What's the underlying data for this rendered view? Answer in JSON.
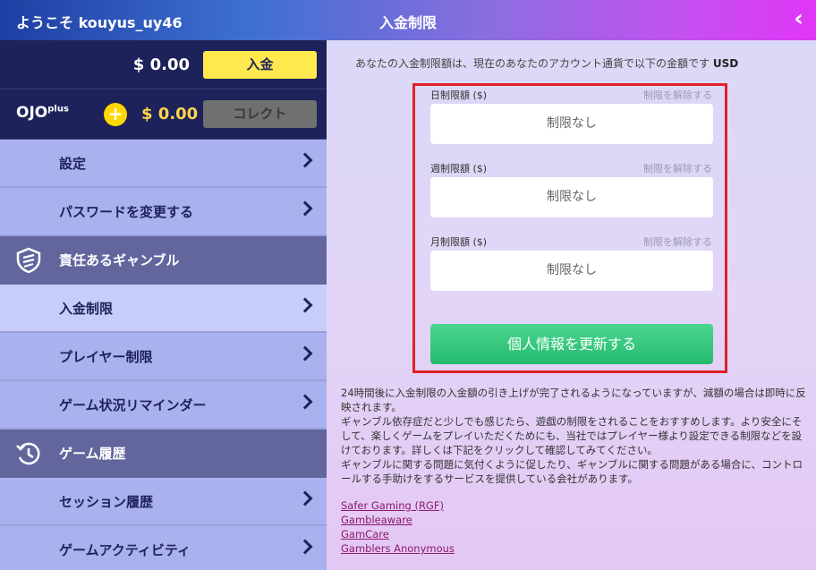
{
  "header": {
    "welcome": "ようこそ kouyus_uy46",
    "title": "入金制限",
    "back_icon": "‹"
  },
  "balance": {
    "amount": "$ 0.00",
    "deposit_label": "入金"
  },
  "ojoplus": {
    "logo": "OJO",
    "logo_sup": "plus",
    "plus_symbol": "+",
    "amount": "$ 0.00",
    "collect_label": "コレクト"
  },
  "menu": {
    "settings": "設定",
    "change_password": "パスワードを変更する",
    "rg_section": "責任あるギャンブル",
    "deposit_limits": "入金制限",
    "player_limits": "プレイヤー制限",
    "reality_check": "ゲーム状況リマインダー",
    "history_section": "ゲーム履歴",
    "session_history": "セッション履歴",
    "game_activity": "ゲームアクティビティ"
  },
  "content": {
    "intro": "あなたの入金制限額は、現在のあなたのアカウント通貨で以下の金額です",
    "currency": "USD",
    "limits": [
      {
        "label": "日制限額 ($)",
        "remove": "制限を解除する",
        "value": "制限なし"
      },
      {
        "label": "週制限額 ($)",
        "remove": "制限を解除する",
        "value": "制限なし"
      },
      {
        "label": "月制限額 ($)",
        "remove": "制限を解除する",
        "value": "制限なし"
      }
    ],
    "update_button": "個人情報を更新する",
    "notice": [
      "24時間後に入金制限の入金額の引き上げが完了されるようになっていますが、減額の場合は即時に反映されます。",
      "ギャンブル依存症だと少しでも感じたら、遊戯の制限をされることをおすすめします。より安全にそして、楽しくゲームをプレイいただくためにも、当社ではプレイヤー様より設定できる制限などを設けております。詳しくは下記をクリックして確認してみてください。",
      "ギャンブルに関する問題に気付くように促したり、ギャンブルに関する問題がある場合に、コントロールする手助けをするサービスを提供している会社があります。"
    ],
    "links": [
      "Safer Gaming (RGF)",
      "Gambleaware",
      "GamCare",
      "Gamblers Anonymous"
    ]
  },
  "colors": {
    "accent_yellow": "#ffe94f",
    "sidebar_dark": "#1e225a",
    "update_green": "#25bb6e",
    "highlight_red": "#e0202a"
  }
}
